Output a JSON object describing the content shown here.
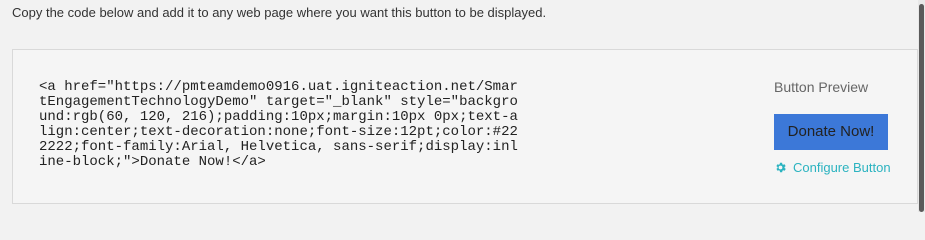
{
  "instructions": "Copy the code below and add it to any web page where you want this button to be displayed.",
  "code": {
    "lines": [
      "<a href=\"https://pmteamdemo0916.uat.igniteaction.net/Smar",
      "tEngagementTechnologyDemo\" target=\"_blank\" style=\"backgro",
      "und:rgb(60, 120, 216);padding:10px;margin:10px 0px;text-a",
      "lign:center;text-decoration:none;font-size:12pt;color:#22",
      "2222;font-family:Arial, Helvetica, sans-serif;display:inl",
      "ine-block;\">Donate Now!</a>"
    ]
  },
  "preview": {
    "title": "Button Preview",
    "button_label": "Donate Now!",
    "configure_label": "Configure Button",
    "configure_icon": "gear-icon"
  },
  "colors": {
    "button_bg": "#3c78d8",
    "button_text": "#222222",
    "link": "#2bb3c0"
  }
}
